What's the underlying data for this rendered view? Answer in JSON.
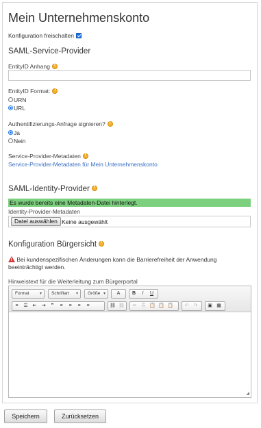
{
  "page_title": "Mein Unternehmenskonto",
  "config_enable": {
    "label": "Konfiguration freischalten",
    "checked": true
  },
  "saml_sp": {
    "heading": "SAML-Service-Provider",
    "entity_suffix_label": "EntityID Anhang",
    "entity_suffix_value": "",
    "entity_format_label": "EntityID Format:",
    "entity_format_options": [
      "URN",
      "URL"
    ],
    "entity_format_selected": "URL",
    "sign_label": "Authentifizierungs-Anfrage signieren?",
    "sign_options": [
      "Ja",
      "Nein"
    ],
    "sign_selected": "Ja",
    "metadata_label": "Service-Provider-Metadaten",
    "metadata_link": "Service-Provider-Metadaten für Mein Unternehmenskonto"
  },
  "saml_idp": {
    "heading": "SAML-Identity-Provider",
    "notice": "Es wurde bereits eine Metadaten-Datei hinterlegt.",
    "metadata_label": "Identity-Provider-Metadaten",
    "file_button": "Datei auswählen",
    "file_status": "Keine ausgewählt"
  },
  "citizen_view": {
    "heading": "Konfiguration Bürgersicht",
    "warning_line1": "Bei kundenspezifischen Änderungen kann die Barrierefreiheit der Anwendung",
    "warning_line2": "beeinträchtigt werden.",
    "hint_label": "Hinweistext für die Weiterleitung zum Bürgerportal",
    "editor": {
      "format_label": "Format",
      "font_label": "Schriftart",
      "size_label": "Größe",
      "text_color_label": "A",
      "bold": "B",
      "italic": "I",
      "underline": "U"
    }
  },
  "buttons": {
    "save": "Speichern",
    "reset": "Zurücksetzen"
  },
  "colors": {
    "accent": "#1a73e8",
    "success_bg": "#7cd07e",
    "link": "#3a6fc4",
    "warning": "#d23b3b",
    "info": "#f5b335"
  }
}
